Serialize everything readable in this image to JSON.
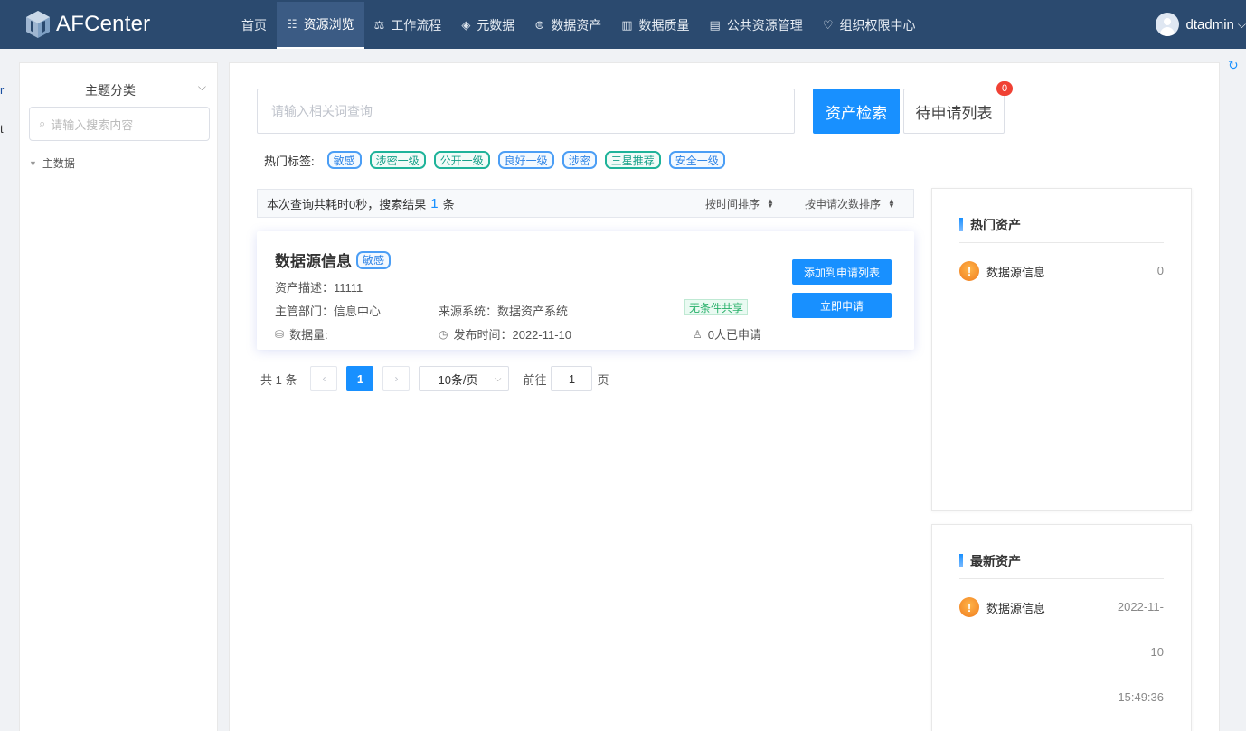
{
  "header": {
    "logo_text": "AFCenter",
    "nav": [
      {
        "label": "首页",
        "icon": "",
        "active": false
      },
      {
        "label": "资源浏览",
        "icon": "list-icon",
        "active": true
      },
      {
        "label": "工作流程",
        "icon": "workflow-icon",
        "active": false
      },
      {
        "label": "元数据",
        "icon": "layers-icon",
        "active": false
      },
      {
        "label": "数据资产",
        "icon": "asset-icon",
        "active": false
      },
      {
        "label": "数据质量",
        "icon": "chart-icon",
        "active": false
      },
      {
        "label": "公共资源管理",
        "icon": "doc-icon",
        "active": false
      },
      {
        "label": "组织权限中心",
        "icon": "heart-icon",
        "active": false
      }
    ],
    "username": "dtadmin"
  },
  "sidebar": {
    "title": "主题分类",
    "search_placeholder": "请输入搜索内容",
    "tree": [
      {
        "label": "主数据"
      }
    ]
  },
  "search": {
    "placeholder": "请输入相关词查询",
    "search_button": "资产检索",
    "pending_button": "待申请列表",
    "pending_count": "0"
  },
  "hot_tags": {
    "label": "热门标签:",
    "tags": [
      {
        "text": "敏感",
        "color": "blue"
      },
      {
        "text": "涉密一级",
        "color": "green"
      },
      {
        "text": "公开一级",
        "color": "green"
      },
      {
        "text": "良好一级",
        "color": "blue"
      },
      {
        "text": "涉密",
        "color": "blue"
      },
      {
        "text": "三星推荐",
        "color": "green"
      },
      {
        "text": "安全一级",
        "color": "blue"
      }
    ]
  },
  "result_bar": {
    "prefix": "本次查询共耗时0秒，搜索结果",
    "count": "1",
    "suffix": "条",
    "sort_time": "按时间排序",
    "sort_requests": "按申请次数排序"
  },
  "result_card": {
    "title": "数据源信息",
    "tag": "敏感",
    "desc": "资产描述：11111",
    "dept": "主管部门：信息中心",
    "source": "来源系统：数据资产系统",
    "share": "无条件共享",
    "volume": "数据量:",
    "publish": "发布时间：2022-11-10",
    "applied": "0人已申请",
    "add_button": "添加到申请列表",
    "apply_button": "立即申请"
  },
  "pagination": {
    "total": "共 1 条",
    "prev": "‹",
    "current": "1",
    "next": "›",
    "page_size": "10条/页",
    "goto_label": "前往",
    "goto_value": "1",
    "page_suffix": "页"
  },
  "hot_assets": {
    "title": "热门资产",
    "items": [
      {
        "name": "数据源信息",
        "value": "0"
      }
    ]
  },
  "latest_assets": {
    "title": "最新资产",
    "items": [
      {
        "name": "数据源信息",
        "date_line1": "2022-11-",
        "date_line2": "10",
        "date_line3": "15:49:36"
      }
    ]
  },
  "colors": {
    "header_bg": "#2b4a6f",
    "accent": "#1890ff",
    "tag_blue": "#4b9ef5",
    "tag_green": "#1fb39a",
    "badge": "#f04134"
  }
}
